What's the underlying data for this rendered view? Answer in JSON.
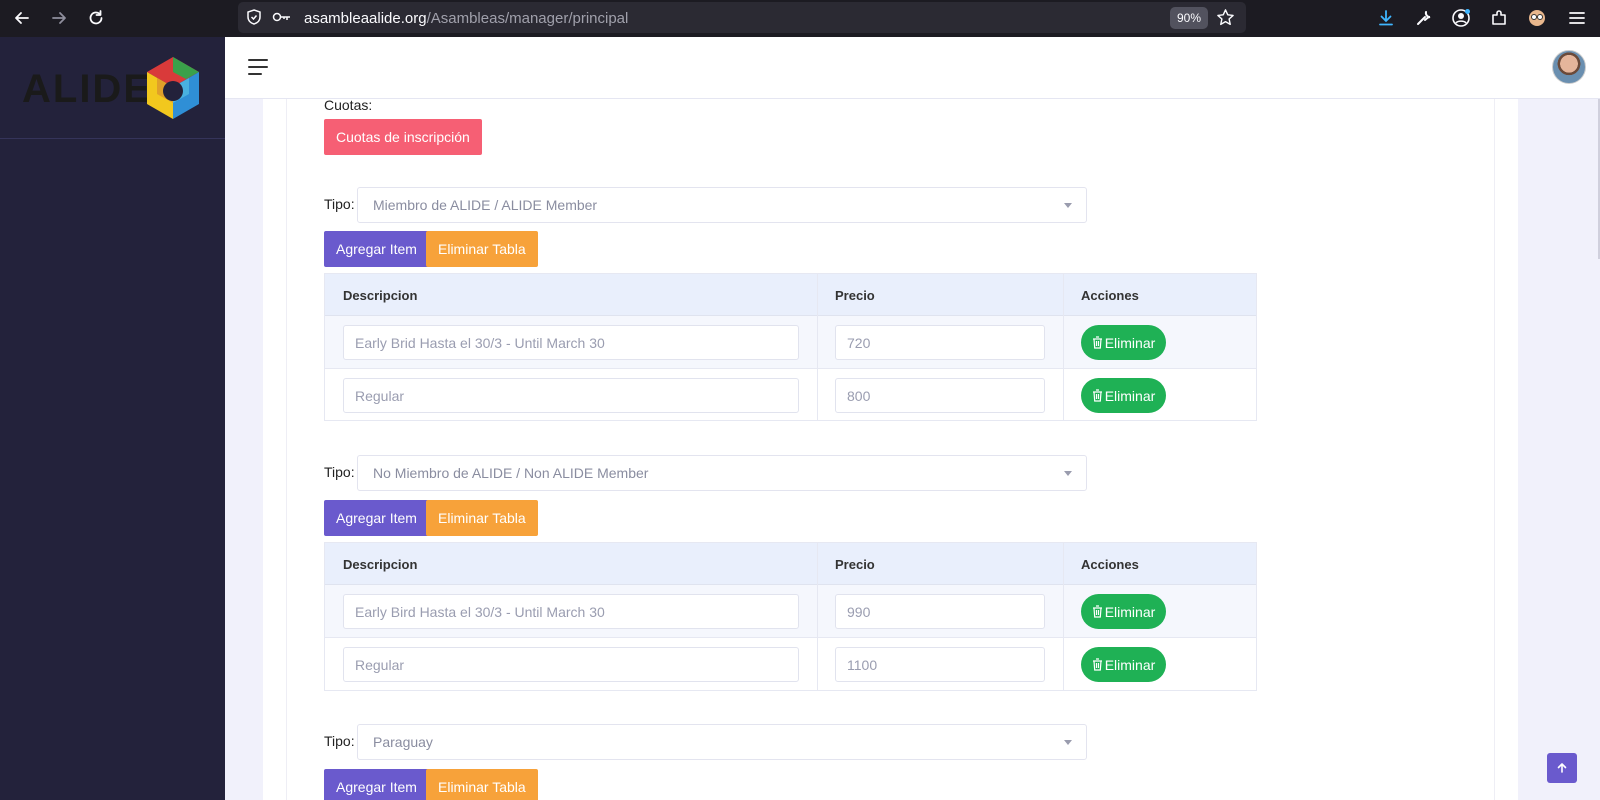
{
  "browser": {
    "url_host": "asambleaalide.org",
    "url_path": "/Asambleas/manager/principal",
    "zoom": "90%"
  },
  "sidebar": {
    "logo_text": "ALIDE"
  },
  "cuotas": {
    "label": "Cuotas:",
    "button": "Cuotas de inscripción"
  },
  "sections": [
    {
      "tipo_label": "Tipo:",
      "tipo_value": "Miembro de ALIDE / ALIDE Member",
      "add_button": "Agregar Item",
      "delete_table_button": "Eliminar Tabla",
      "columns": [
        "Descripcion",
        "Precio",
        "Acciones"
      ],
      "rows": [
        {
          "descripcion": "Early Brid Hasta el 30/3 - Until March 30",
          "precio": "720",
          "action": "Eliminar"
        },
        {
          "descripcion": "Regular",
          "precio": "800",
          "action": "Eliminar"
        }
      ]
    },
    {
      "tipo_label": "Tipo:",
      "tipo_value": "No Miembro de ALIDE / Non ALIDE Member",
      "add_button": "Agregar Item",
      "delete_table_button": "Eliminar Tabla",
      "columns": [
        "Descripcion",
        "Precio",
        "Acciones"
      ],
      "rows": [
        {
          "descripcion": "Early Bird Hasta el 30/3 - Until March 30",
          "precio": "990",
          "action": "Eliminar"
        },
        {
          "descripcion": "Regular",
          "precio": "1100",
          "action": "Eliminar"
        }
      ]
    },
    {
      "tipo_label": "Tipo:",
      "tipo_value": "Paraguay",
      "add_button": "Agregar Item",
      "delete_table_button": "Eliminar Tabla"
    }
  ],
  "colors": {
    "primary": "#6a5acd",
    "warning": "#f7a23a",
    "danger": "#f65f74",
    "success": "#1fb155",
    "sidebar": "#23223b"
  },
  "icons": [
    "back-icon",
    "forward-icon",
    "reload-icon",
    "shield-icon",
    "key-icon",
    "star-icon",
    "download-icon",
    "wrench-icon",
    "account-icon",
    "extensions-icon",
    "menu-icon",
    "hamburger-icon",
    "trash-icon",
    "arrow-up-icon"
  ]
}
